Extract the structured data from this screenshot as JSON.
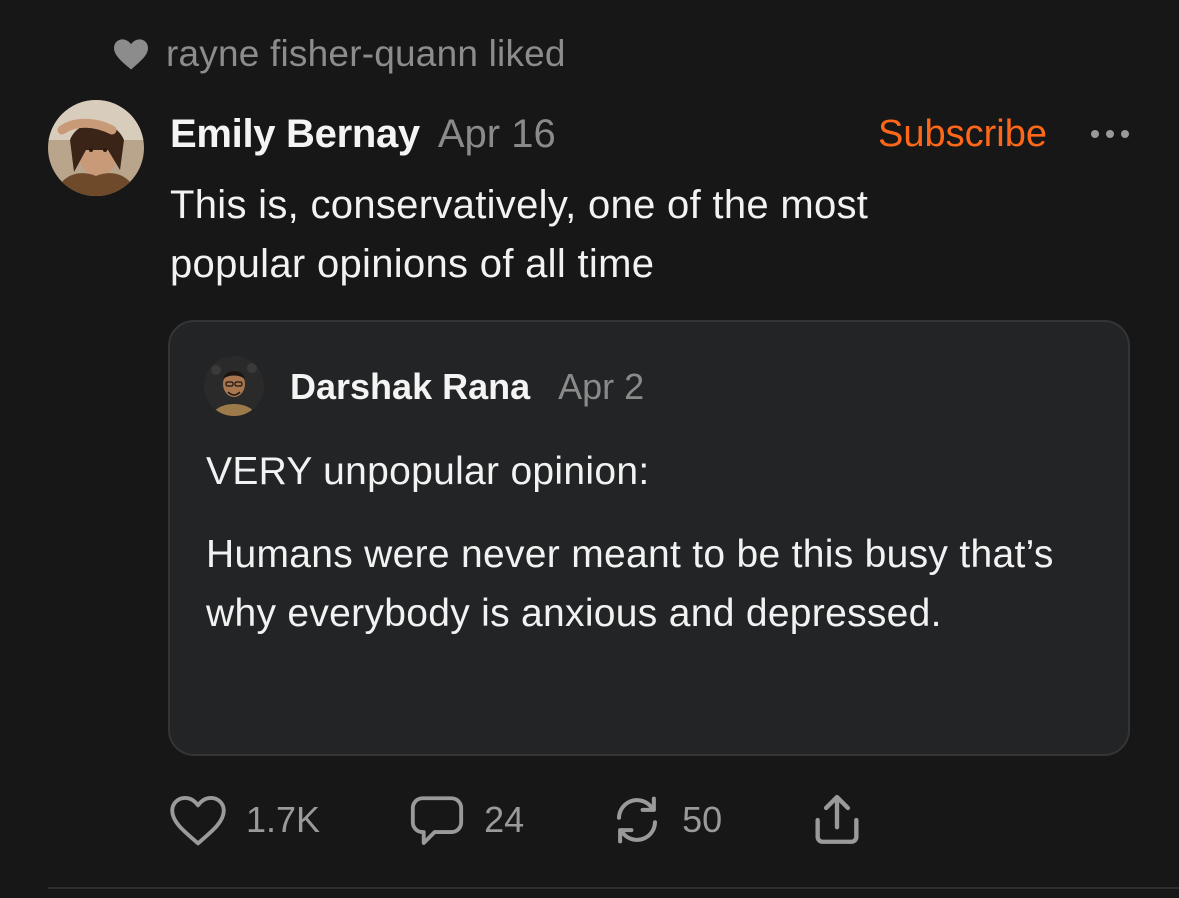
{
  "activity": {
    "icon": "heart-icon",
    "text": "rayne fisher-quann liked"
  },
  "post": {
    "author": "Emily Bernay",
    "date": "Apr 16",
    "subscribe_label": "Subscribe",
    "more_icon": "more-horizontal-icon",
    "body_lines": [
      "This is, conservatively, one of the most",
      "popular opinions of all time"
    ]
  },
  "quote": {
    "author": "Darshak Rana",
    "date": "Apr 2",
    "paragraphs": [
      "VERY unpopular opinion:",
      "Humans were never meant to be this busy that’s why everybody is anxious and depressed."
    ]
  },
  "actions": {
    "likes": "1.7K",
    "comments": "24",
    "restacks": "50",
    "icons": [
      "heart-icon",
      "comment-icon",
      "restack-icon",
      "share-icon"
    ]
  },
  "colors": {
    "background": "#171717",
    "card": "#222425",
    "accent": "#ff6719",
    "muted": "#8a8a8a"
  }
}
